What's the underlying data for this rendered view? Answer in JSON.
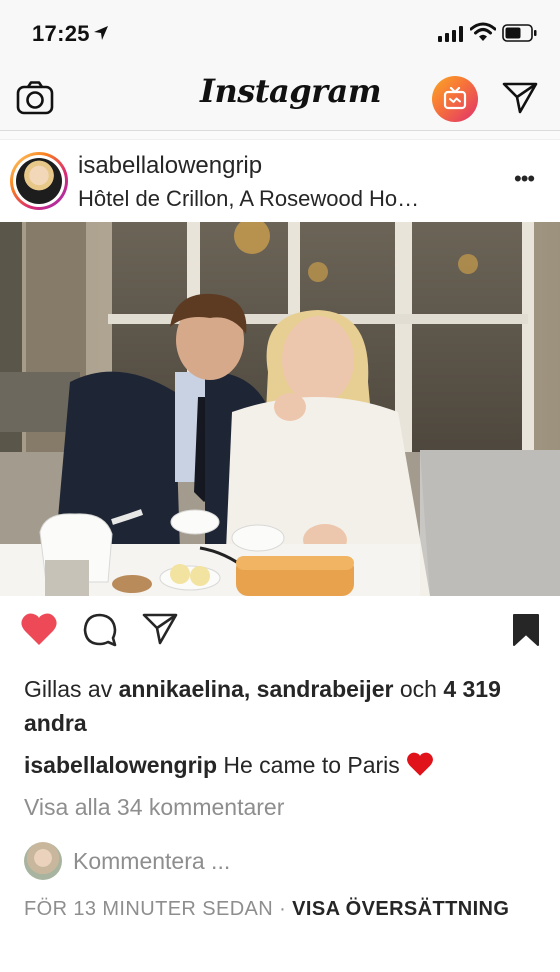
{
  "status": {
    "time": "17:25"
  },
  "nav": {
    "logo": "Instagram"
  },
  "post": {
    "username": "isabellalowengrip",
    "location": "Hôtel de Crillon, A Rosewood Ho…",
    "liked": true,
    "likes": {
      "prefix": "Gillas av",
      "user1": "annikaelina",
      "sep": ",",
      "user2": "sandrabeijer",
      "och": "och",
      "others": "4 319 andra"
    },
    "caption": {
      "user": "isabellalowengrip",
      "text": "He came to Paris"
    },
    "view_comments": "Visa alla 34 kommentarer",
    "comment_placeholder": "Kommentera ...",
    "timestamp": "FÖR 13 MINUTER SEDAN",
    "dot": "·",
    "translate": "VISA ÖVERSÄTTNING"
  },
  "colors": {
    "like_red": "#ed4956",
    "text": "#262626",
    "muted": "#8e8e8e"
  }
}
